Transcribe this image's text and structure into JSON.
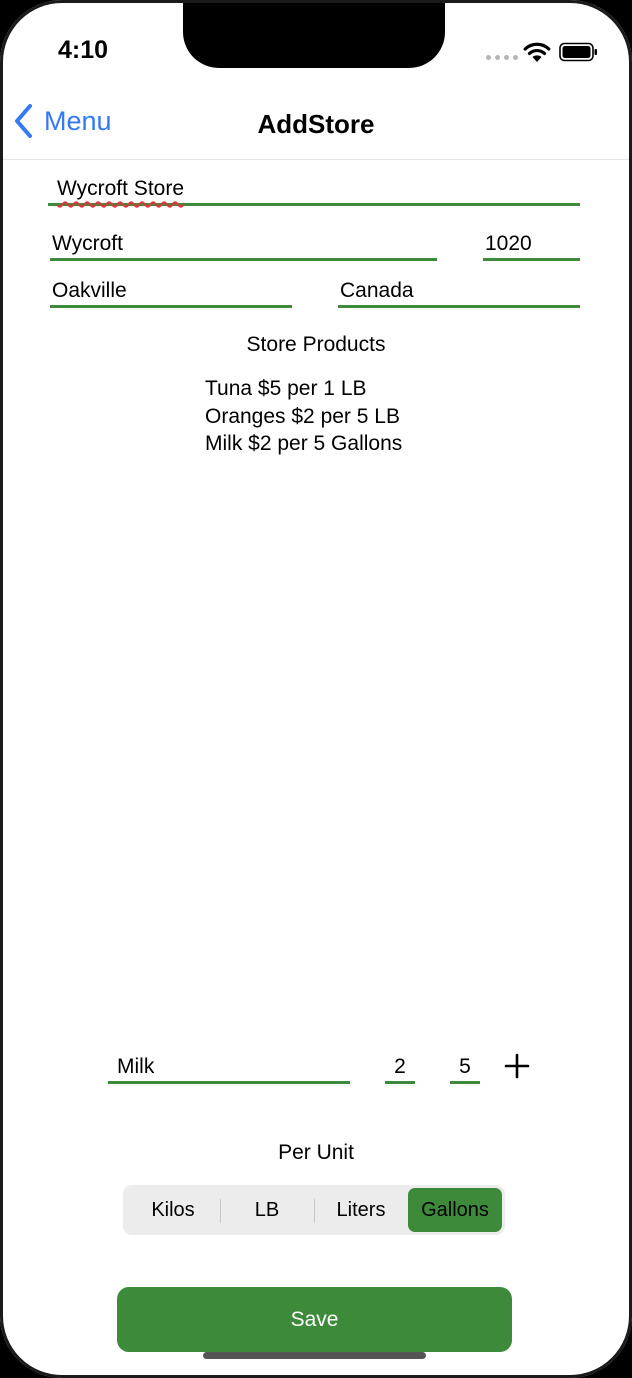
{
  "status_bar": {
    "time": "4:10"
  },
  "nav": {
    "back_label": "Menu",
    "title": "AddStore"
  },
  "store": {
    "name": "Wycroft Store",
    "street": "Wycroft",
    "number": "1020",
    "city": "Oakville",
    "country": "Canada"
  },
  "products": {
    "title": "Store Products",
    "items": [
      "Tuna $5 per 1 LB",
      "Oranges $2 per 5 LB",
      "Milk $2 per 5 Gallons"
    ]
  },
  "new_product": {
    "name": "Milk",
    "price": "2",
    "quantity": "5"
  },
  "unit_picker": {
    "label": "Per Unit",
    "options": [
      "Kilos",
      "LB",
      "Liters",
      "Gallons"
    ],
    "selected": "Gallons"
  },
  "actions": {
    "save_label": "Save"
  },
  "colors": {
    "accent": "#3d8a3a",
    "link": "#3478f6"
  }
}
